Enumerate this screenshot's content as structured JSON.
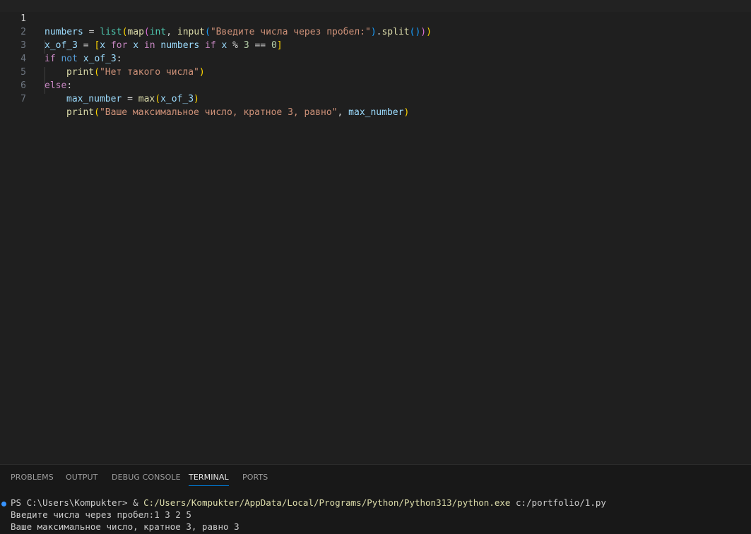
{
  "editor": {
    "line_numbers": [
      "1",
      "2",
      "3",
      "4",
      "5",
      "6",
      "7"
    ],
    "line1": {
      "a": "numbers",
      "b": " = ",
      "c": "list",
      "d": "(",
      "e": "map",
      "f": "(",
      "g": "int",
      "h": ", ",
      "i": "input",
      "j": "(",
      "k": "\"Введите числа через пробел:\"",
      "l": ")",
      "m": ".",
      "n": "split",
      "o": "()",
      "p": ")",
      "q": ")"
    },
    "line2": {
      "a": "x_of_3",
      "b": " = ",
      "c": "[",
      "d": "x",
      "e": " for ",
      "f": "x",
      "g": " in ",
      "h": "numbers",
      "i": " if ",
      "j": "x",
      "k": " % ",
      "l": "3",
      "m": " == ",
      "n": "0",
      "o": "]"
    },
    "line3": {
      "a": "if",
      "b": " not ",
      "c": "x_of_3",
      "d": ":"
    },
    "line4": {
      "a": "print",
      "b": "(",
      "c": "\"Нет такого числа\"",
      "d": ")"
    },
    "line5": {
      "a": "else",
      "b": ":"
    },
    "line6": {
      "a": "max_number",
      "b": " = ",
      "c": "max",
      "d": "(",
      "e": "x_of_3",
      "f": ")"
    },
    "line7": {
      "a": "print",
      "b": "(",
      "c": "\"Ваше максимальное число, кратное 3, равно\"",
      "d": ", ",
      "e": "max_number",
      "f": ")"
    }
  },
  "panel": {
    "tabs": [
      "PROBLEMS",
      "OUTPUT",
      "DEBUG CONSOLE",
      "TERMINAL",
      "PORTS"
    ],
    "active_tab": "TERMINAL"
  },
  "terminal": {
    "prompt": "PS C:\\Users\\Kompukter> ",
    "amp": "& ",
    "exe_path": "C:/Users/Kompukter/AppData/Local/Programs/Python/Python313/python.exe",
    "script_arg": " c:/portfolio/1.py",
    "output_line1": "Введите числа через пробел:1 3 2 5",
    "output_line2": "Ваше максимальное число, кратное 3, равно 3"
  },
  "colors": {
    "background": "#1f1f1f",
    "panel_background": "#181818",
    "active_tab_underline": "#0078d4",
    "terminal_dot": "#3794ff"
  }
}
